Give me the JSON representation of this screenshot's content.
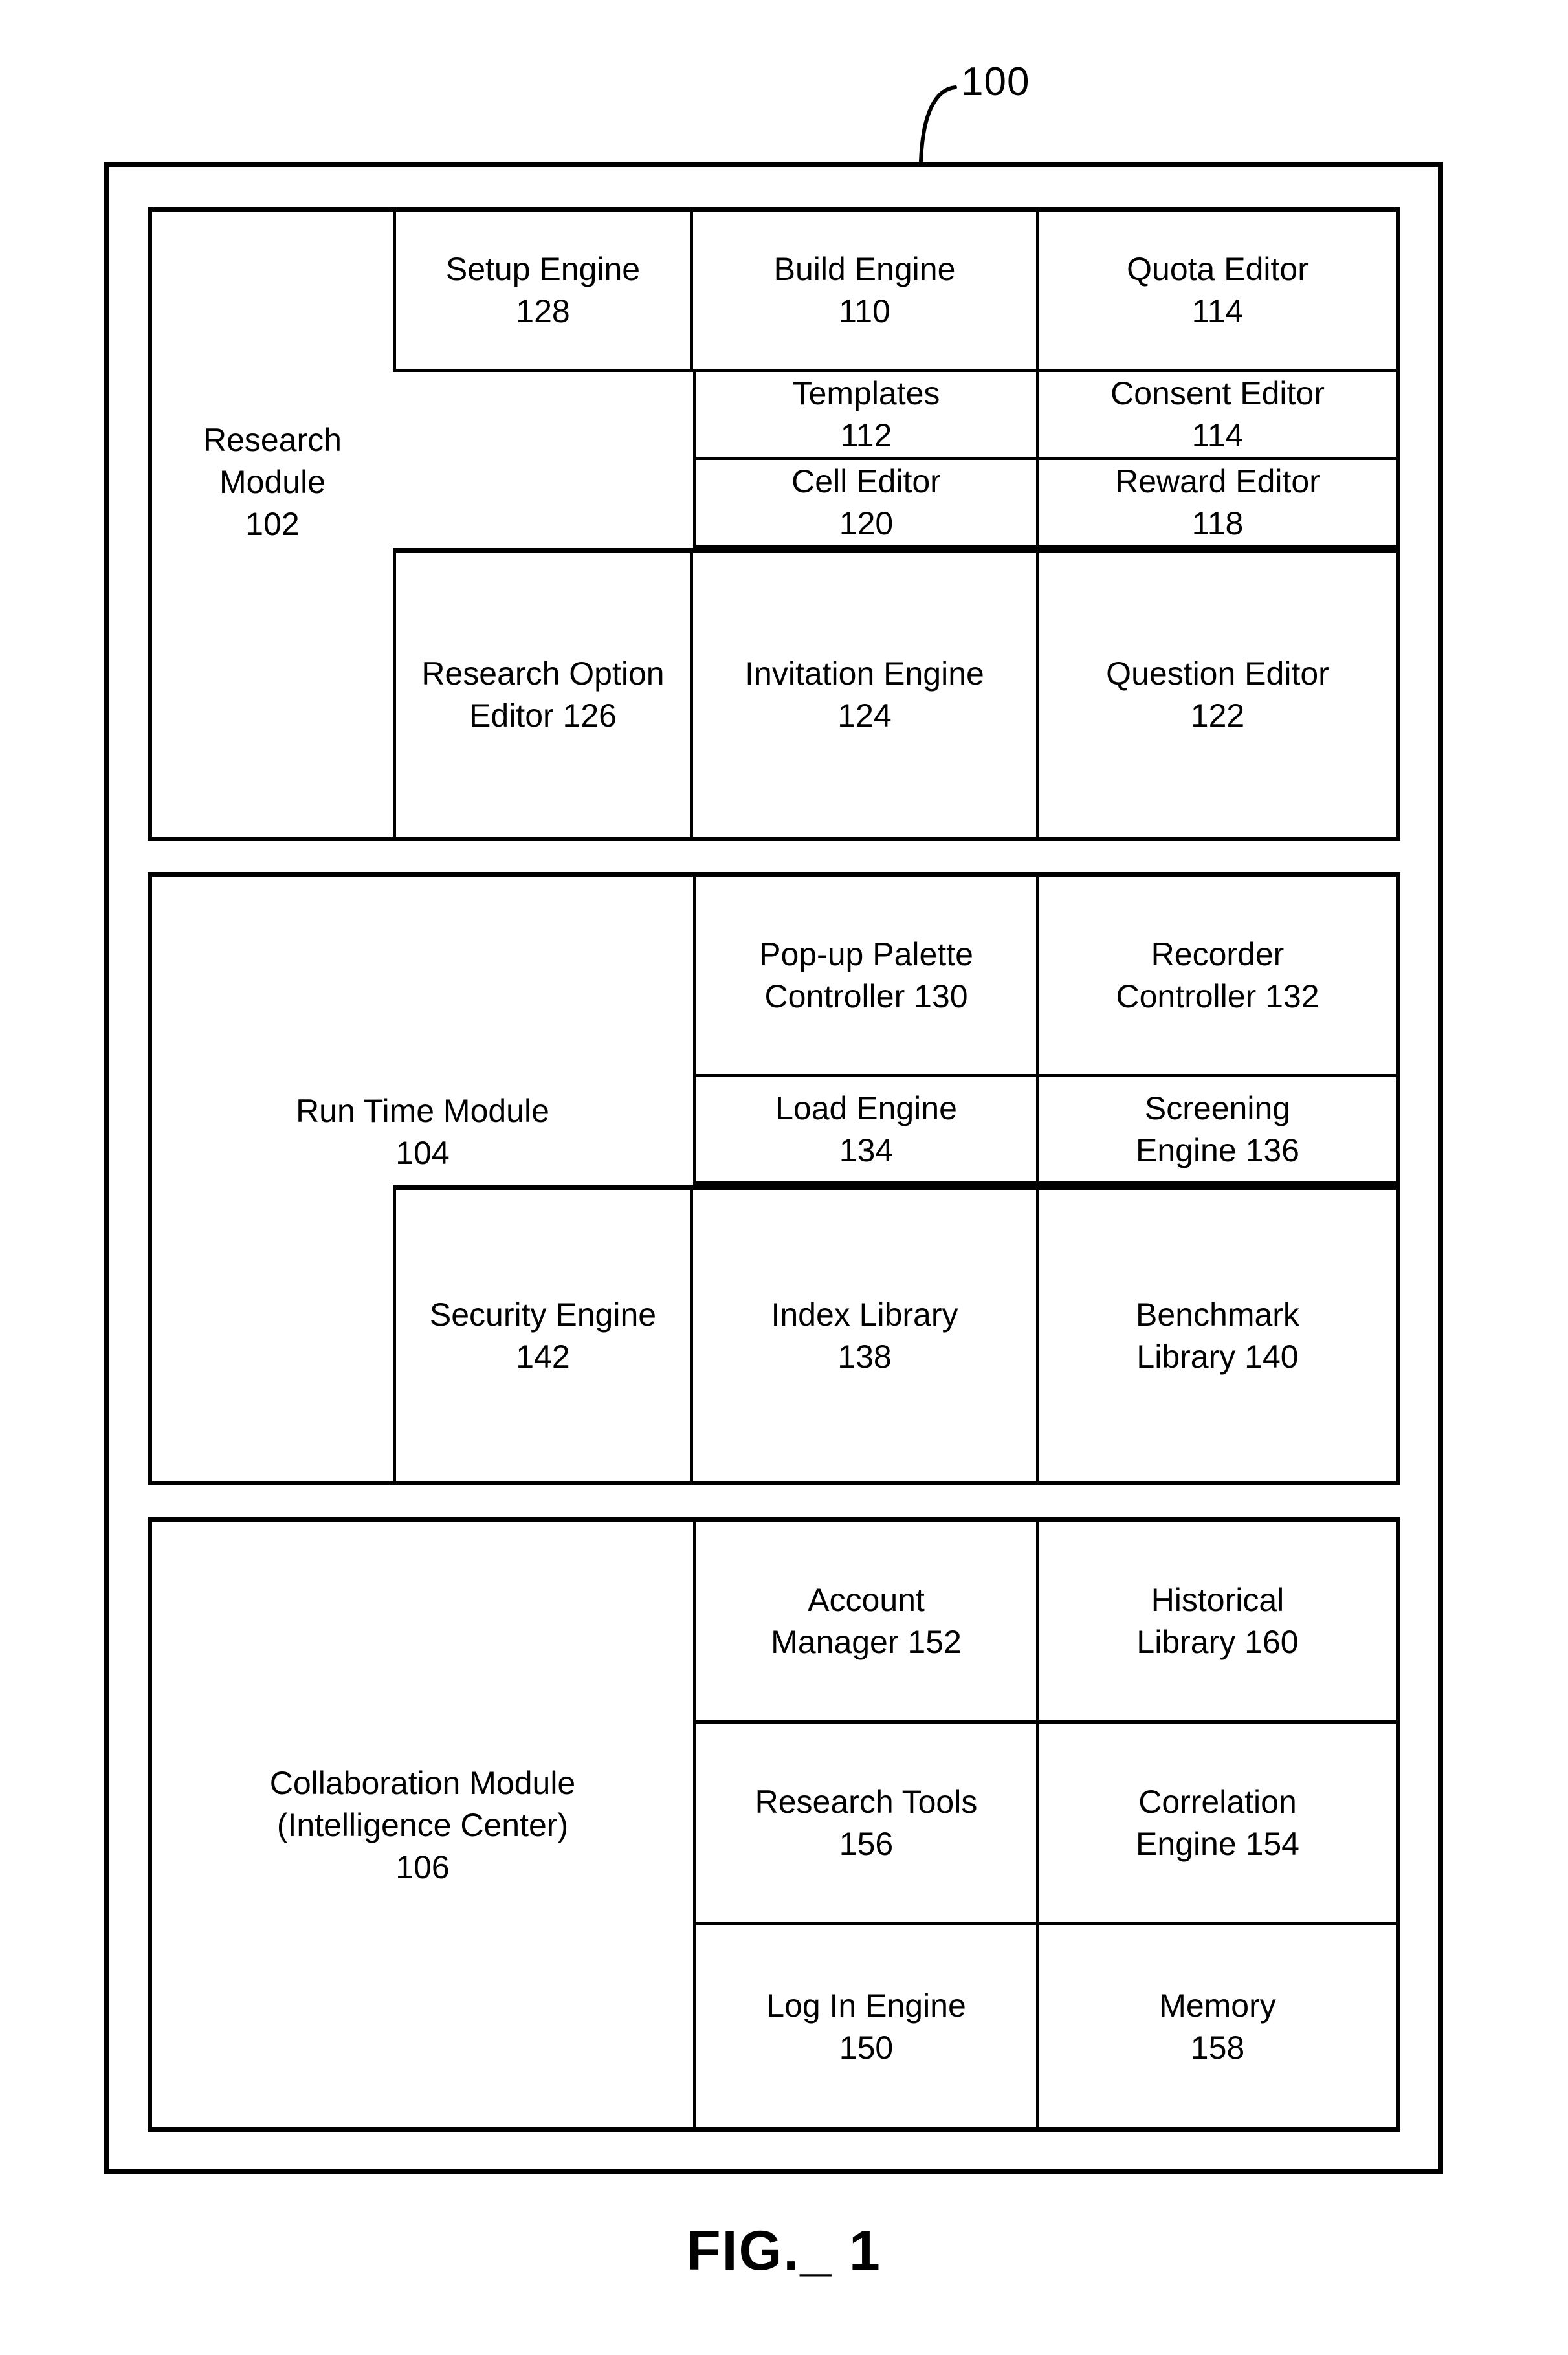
{
  "figure": {
    "system_ref": "100",
    "caption": "FIG._ 1"
  },
  "modules": [
    {
      "id": "research",
      "label_line1": "Research Module",
      "label_line2": "102",
      "rows": [
        {
          "cells": [
            {
              "line1": "Setup Engine",
              "line2": "128"
            },
            {
              "line1": "Build Engine",
              "line2": "110"
            },
            {
              "line1": "Quota Editor",
              "line2": "114"
            }
          ]
        },
        {
          "cells": [
            {
              "line1": "Templates",
              "line2": "112"
            },
            {
              "line1": "Consent Editor",
              "line2": "114"
            }
          ]
        },
        {
          "cells": [
            {
              "line1": "Cell Editor",
              "line2": "120"
            },
            {
              "line1": "Reward Editor",
              "line2": "118"
            }
          ]
        },
        {
          "cells": [
            {
              "line1": "Research Option",
              "line2": "Editor 126"
            },
            {
              "line1": "Invitation Engine",
              "line2": "124"
            },
            {
              "line1": "Question Editor",
              "line2": "122"
            }
          ]
        }
      ]
    },
    {
      "id": "runtime",
      "label_line1": "Run Time Module",
      "label_line2": "104",
      "rows": [
        {
          "cells": [
            {
              "line1": "Pop-up Palette",
              "line2": "Controller 130"
            },
            {
              "line1": "Recorder",
              "line2": "Controller 132"
            }
          ]
        },
        {
          "cells": [
            {
              "line1": "Load Engine",
              "line2": "134"
            },
            {
              "line1": "Screening",
              "line2": "Engine 136"
            }
          ]
        },
        {
          "cells": [
            {
              "line1": "Security Engine",
              "line2": "142"
            },
            {
              "line1": "Index Library",
              "line2": "138"
            },
            {
              "line1": "Benchmark",
              "line2": "Library 140"
            }
          ]
        }
      ]
    },
    {
      "id": "collaboration",
      "label_line1": "Collaboration Module",
      "label_line2": "(Intelligence Center)",
      "label_line3": "106",
      "rows": [
        {
          "cells": [
            {
              "line1": "Account",
              "line2": "Manager 152"
            },
            {
              "line1": "Historical",
              "line2": "Library 160"
            }
          ]
        },
        {
          "cells": [
            {
              "line1": "Research Tools",
              "line2": "156"
            },
            {
              "line1": "Correlation",
              "line2": "Engine 154"
            }
          ]
        },
        {
          "cells": [
            {
              "line1": "Log In Engine",
              "line2": "150"
            },
            {
              "line1": "Memory",
              "line2": "158"
            }
          ]
        }
      ]
    }
  ]
}
